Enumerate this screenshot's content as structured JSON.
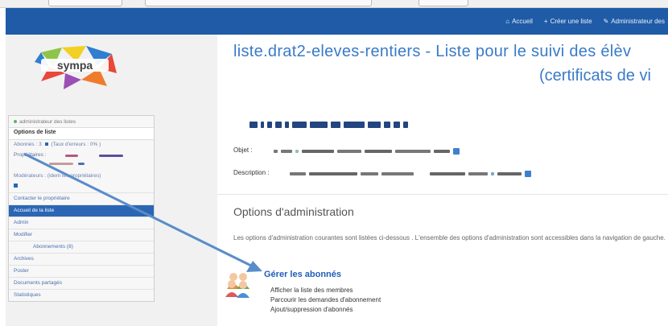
{
  "topnav": {
    "items": [
      {
        "icon": "home-icon",
        "label": "Accueil"
      },
      {
        "icon": "plus-icon",
        "label": "Créer une liste"
      },
      {
        "icon": "wrench-icon",
        "label": "Administrateur des"
      }
    ]
  },
  "logo": {
    "text": "sympa"
  },
  "sidebar": {
    "role": "administrateur des listes",
    "title": "Options de liste",
    "subscribers": "Abonnés : 3",
    "errors": "(Taux d'erreurs : 0% )",
    "owners_label": "Propriétaires :",
    "moderators": "Modérateurs : (idem les propriétaires)",
    "links": [
      {
        "label": "Contacter le propriétaire",
        "active": false,
        "indent": false
      },
      {
        "label": "Accueil de la liste",
        "active": true,
        "indent": false
      },
      {
        "label": "Admin",
        "active": false,
        "indent": false
      },
      {
        "label": "Modifier",
        "active": false,
        "indent": false
      },
      {
        "label": "Abonnements (8)",
        "active": false,
        "indent": true
      },
      {
        "label": "Archives",
        "active": false,
        "indent": false
      },
      {
        "label": "Poster",
        "active": false,
        "indent": false
      },
      {
        "label": "Documents partagés",
        "active": false,
        "indent": false
      },
      {
        "label": "Statistiques",
        "active": false,
        "indent": false
      }
    ]
  },
  "main": {
    "heading_line1": "liste.drat2-eleves-rentiers - Liste pour le suivi des élèv",
    "heading_line2": "(certificats de vi",
    "object_label": "Objet :",
    "description_label": "Description :",
    "section_title": "Options d'administration",
    "paragraph": "Les options d'administration courantes sont listées ci-dessous . L'ensemble des options d'administration sont accessibles dans la navigation de gauche.",
    "action": {
      "title": "Gérer les abonnés",
      "links": [
        "Afficher la liste des membres",
        "Parcourir les demandes d'abonnement",
        "Ajout/suppression d'abonnés"
      ]
    }
  },
  "colors": {
    "topbar": "#1f5ba6",
    "link": "#1f5fb8",
    "heading": "#3a7ac8",
    "active_nav": "#2a66b4",
    "arrow": "#5a8cc8"
  }
}
